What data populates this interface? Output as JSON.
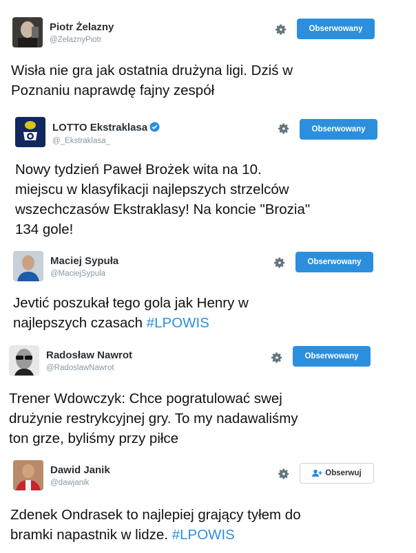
{
  "colors": {
    "accent": "#2b8fdd",
    "text": "#111111",
    "muted": "#8899a6"
  },
  "tweets": [
    {
      "name": "Piotr Żelazny",
      "handle": "@ZelaznyPiotr",
      "button": "Obserwowany",
      "text_lines": [
        "Wisła nie gra jak ostatnia drużyna ligi. Dziś w",
        "Poznaniu naprawdę fajny zespół"
      ]
    },
    {
      "name": "LOTTO Ekstraklasa",
      "handle": "@_Ekstraklasa_",
      "verified": true,
      "button": "Obserwowany",
      "text_lines": [
        "Nowy tydzień Paweł Brożek wita na 10.",
        "miejscu w klasyfikacji najlepszych  strzelców",
        "wszechczasów Ekstraklasy! Na koncie \"Brozia\"",
        "134 gole!"
      ]
    },
    {
      "name": "Maciej Sypuła",
      "handle": "@MaciejSypula",
      "button": "Obserwowany",
      "text_line1": "Jevtić poszukał tego gola jak Henry w",
      "text_line2_prefix": "najlepszych czasach ",
      "hashtag": "#LPOWIS"
    },
    {
      "name": "Radosław Nawrot",
      "handle": "@RadoslawNawrot",
      "button": "Obserwowany",
      "text_lines": [
        "Trener Wdowczyk: Chce pogratulować swej",
        "drużynie restrykcyjnej gry. To my nadawaliśmy",
        "ton grze, byliśmy przy piłce"
      ]
    },
    {
      "name": "Dawid Janik",
      "handle": "@dawjanik",
      "button": "Obserwuj",
      "text_line1": "Zdenek Ondrasek to najlepiej grający tyłem do",
      "text_line2_prefix": "bramki napastnik w lidze. ",
      "hashtag": "#LPOWIS"
    }
  ]
}
